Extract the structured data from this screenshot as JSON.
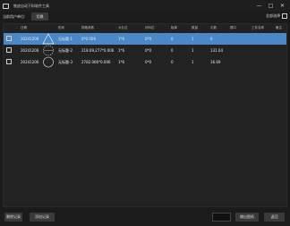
{
  "window": {
    "title": "铁皮自动下料软件工具"
  },
  "toolbar": {
    "current_user_label": "当前用户单位:",
    "user_button": "切换",
    "select_all_label": "全部选择"
  },
  "table": {
    "headers": [
      "日期",
      "形状",
      "规格参数",
      "大孔位",
      "补料位",
      "板厚",
      "数量",
      "孔数",
      "槽口",
      "工件名称",
      "备注"
    ],
    "rows": [
      {
        "date": "20241206",
        "name": "无标题-1",
        "spec": "0*0.006",
        "holes": "1*6",
        "supp": "0*0",
        "qty": "0",
        "count": "1",
        "val": "6",
        "selected": true,
        "shape": "triangle"
      },
      {
        "date": "20241206",
        "name": "无标题-2",
        "spec": "218.09,277*0.006",
        "holes": "1*6",
        "supp": "0*0",
        "qty": "0",
        "count": "1",
        "val": "131.04",
        "selected": false,
        "shape": "dashed-circle"
      },
      {
        "date": "20241206",
        "name": "无标题-3",
        "spec": "2782.066*0.006",
        "holes": "1*6",
        "supp": "0*0",
        "qty": "0",
        "count": "1",
        "val": "16.69",
        "selected": false,
        "shape": "circle"
      }
    ]
  },
  "footer": {
    "delete_button": "删除记录",
    "add_button": "添加记录",
    "export_button": "输出图纸",
    "back_button": "返回",
    "input_value": ""
  },
  "colors": {
    "selected_row": "#4a88c7",
    "background": "#1b1b1b"
  }
}
